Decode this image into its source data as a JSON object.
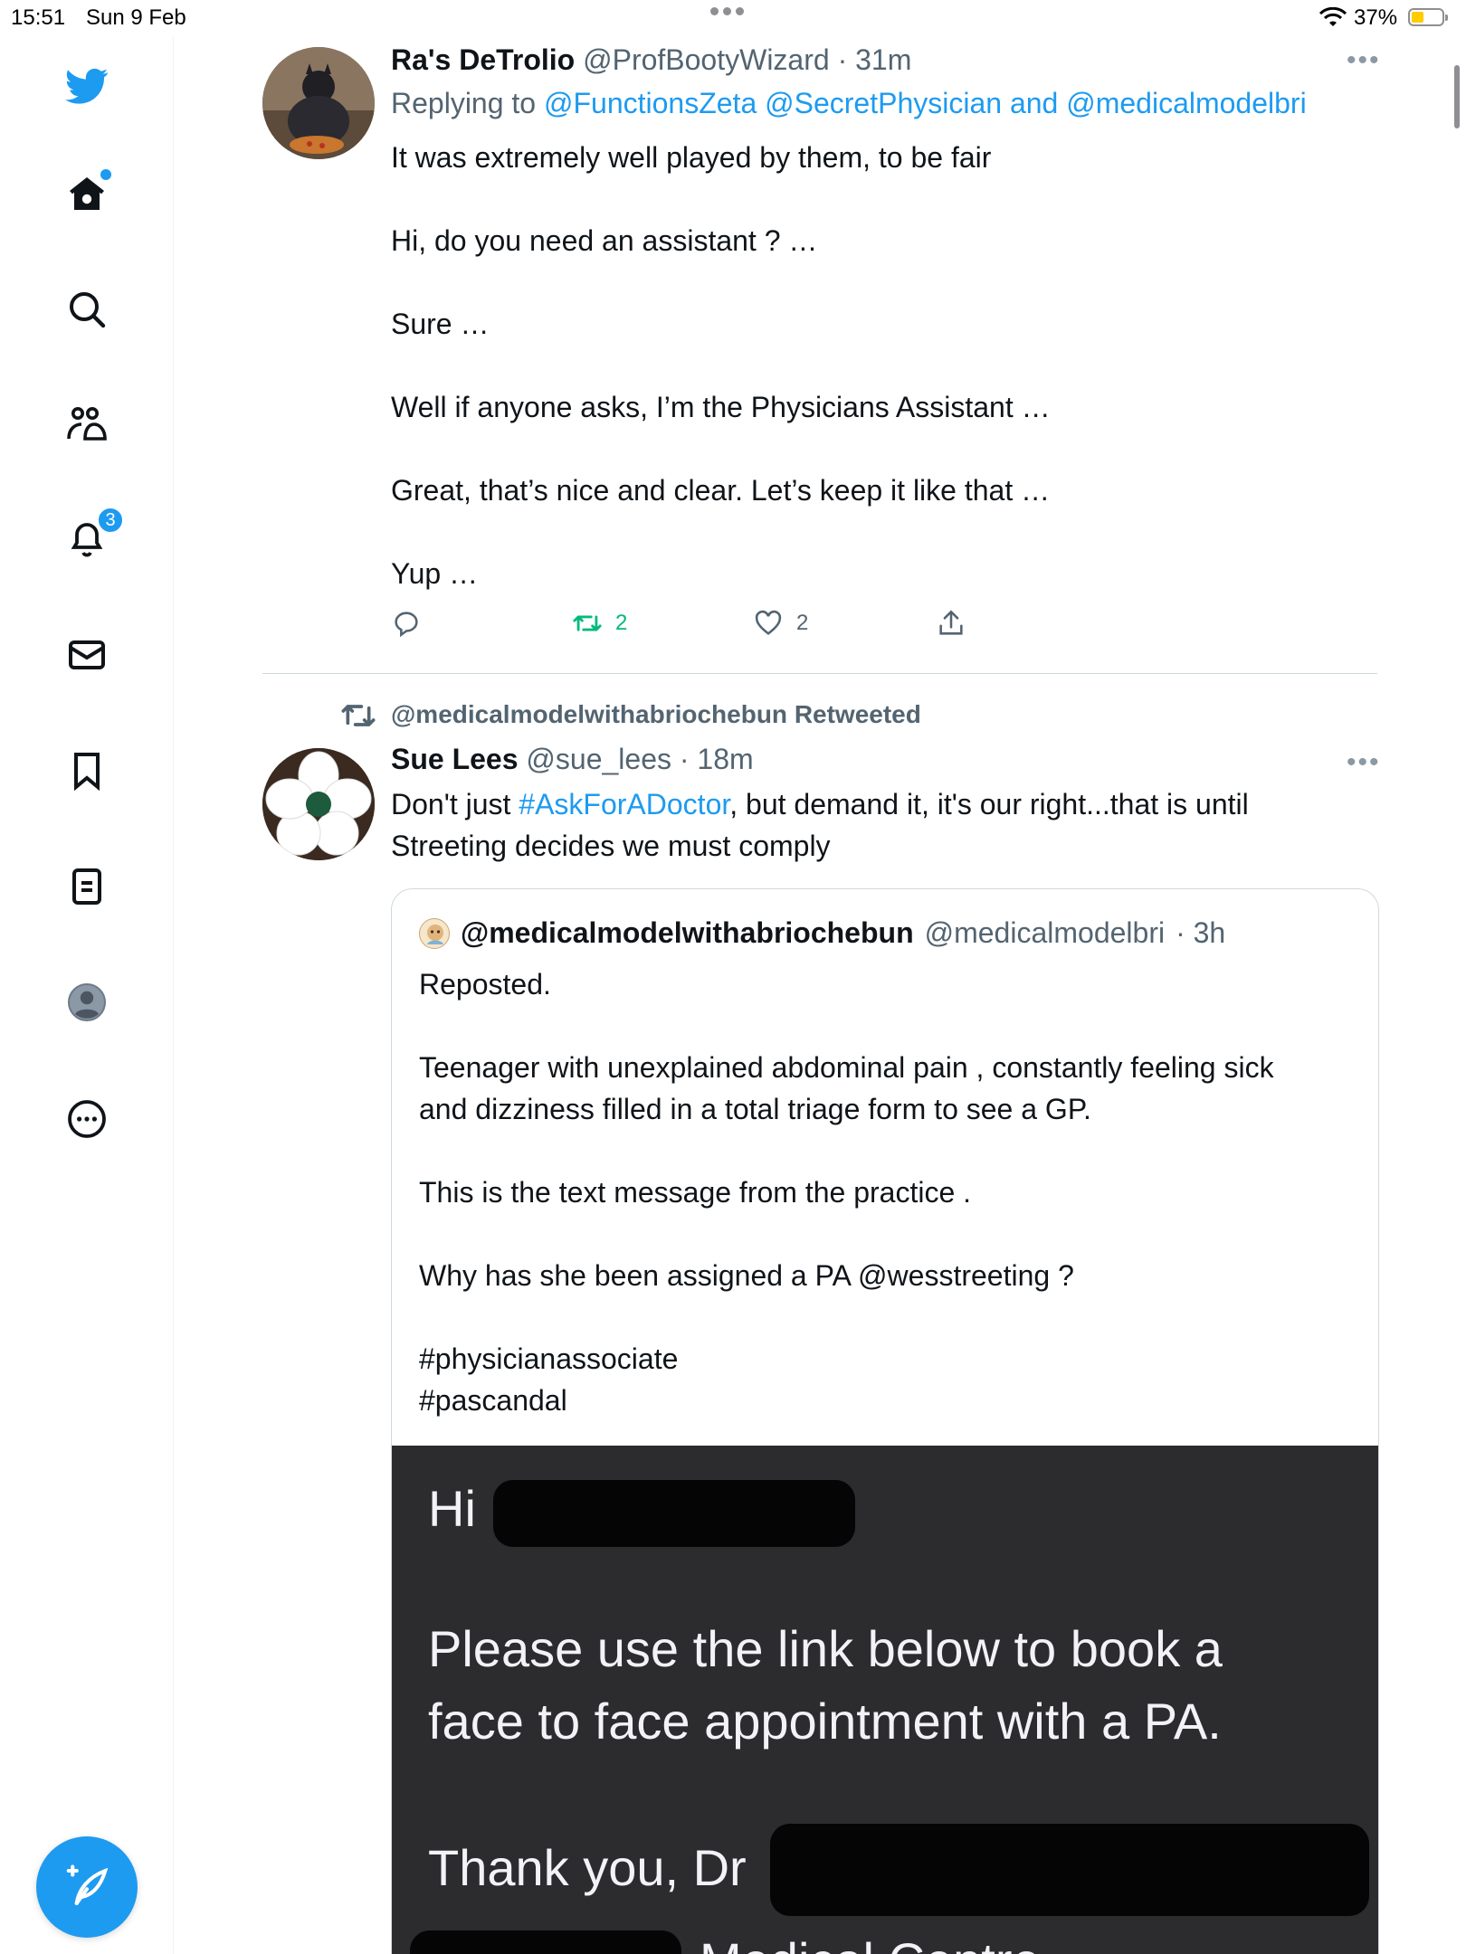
{
  "status_bar": {
    "time": "15:51",
    "date": "Sun 9 Feb",
    "battery": "37%"
  },
  "sidebar": {
    "notifications_badge": "3",
    "items": [
      "home-icon",
      "search-icon",
      "communities-icon",
      "notifications-icon",
      "messages-icon",
      "bookmarks-icon",
      "lists-icon",
      "profile-icon",
      "more-icon"
    ],
    "compose_icon": "compose-icon"
  },
  "colors": {
    "accent": "#1d9bf0",
    "retweet_green": "#00ba7c",
    "text": "#0f1419",
    "muted": "#536471"
  },
  "tweet1": {
    "name": "Ra's DeTrolio",
    "handle": "@ProfBootyWizard",
    "time": "· 31m",
    "replying_to_label": "Replying to",
    "mention1": "@FunctionsZeta",
    "mention2": "@SecretPhysician",
    "and": "and",
    "mention3": "@medicalmodelbri",
    "lines": [
      "It was extremely well played by them, to be fair",
      "",
      "Hi, do you need an assistant ? …",
      "",
      "Sure …",
      "",
      "Well if anyone asks, I’m the Physicians Assistant …",
      "",
      "Great, that’s nice and clear. Let’s keep it like that …",
      "",
      "Yup …"
    ],
    "retweets": "2",
    "likes": "2"
  },
  "retweet_banner": "@medicalmodelwithabriochebun Retweeted",
  "tweet2": {
    "name": "Sue Lees",
    "handle": "@sue_lees",
    "time": "· 18m",
    "text_pre": "Don't just ",
    "hashtag": "#AskForADoctor",
    "text_post": ", but demand it, it's our right...that is until",
    "text_line2": "Streeting decides we must comply"
  },
  "quote": {
    "name": "@medicalmodelwithabriochebun",
    "handle": "@medicalmodelbri",
    "time": "· 3h",
    "lines": [
      "Reposted.",
      "",
      "Teenager with unexplained abdominal pain , constantly feeling sick",
      "and dizziness filled in a total triage form to see a GP.",
      "",
      "This is the text message from the practice .",
      "",
      "Why has she been assigned a PA @wesstreeting ?",
      "",
      "#physicianassociate",
      "#pascandal"
    ],
    "image_text": {
      "greeting": "Hi",
      "line1": "Please use the link below to book a",
      "line2": "face to face appointment with a PA.",
      "signoff": "Thank you, Dr",
      "footer_partial": "Medical Centre"
    }
  }
}
